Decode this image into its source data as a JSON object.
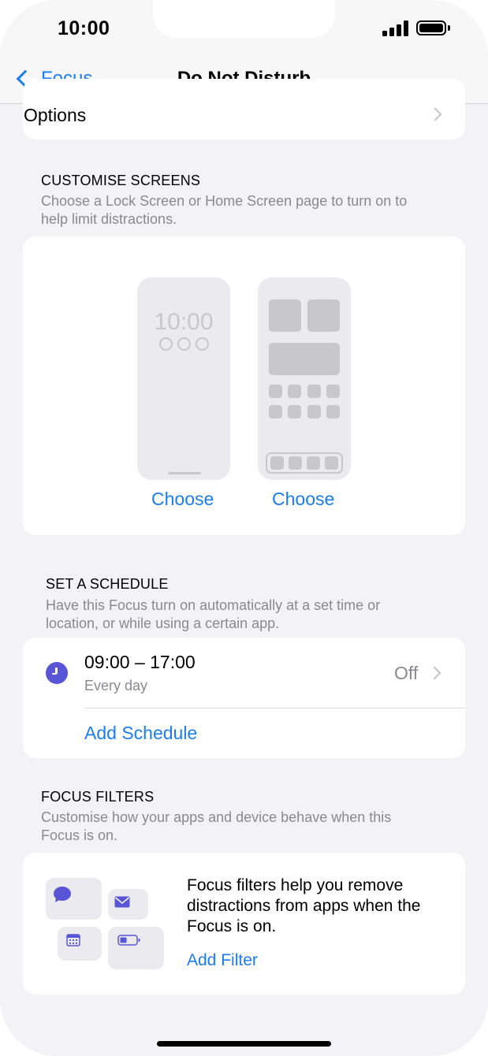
{
  "status_bar": {
    "time": "10:00"
  },
  "nav": {
    "back_label": "Focus",
    "title": "Do Not Disturb"
  },
  "options": {
    "label": "Options"
  },
  "customise": {
    "title": "CUSTOMISE SCREENS",
    "description_line1": "Choose a Lock Screen or Home Screen page to turn on to",
    "description_line2": "help limit distractions.",
    "lock_preview_time": "10:00",
    "lock_choose_label": "Choose",
    "home_choose_label": "Choose"
  },
  "schedule": {
    "title": "SET A SCHEDULE",
    "description_line1": "Have this Focus turn on automatically at a set time or",
    "description_line2": "location, or while using a certain app.",
    "entry": {
      "time_range": "09:00 – 17:00",
      "days": "Every day",
      "status": "Off"
    },
    "add_label": "Add Schedule"
  },
  "filters": {
    "title": "FOCUS FILTERS",
    "description_line1": "Customise how your apps and device behave when this",
    "description_line2": "Focus is on.",
    "info_text": "Focus filters help you remove distractions from apps when the Focus is on.",
    "add_label": "Add Filter",
    "icons": [
      "message-icon",
      "mail-icon",
      "calendar-icon",
      "battery-icon"
    ]
  },
  "colors": {
    "accent": "#1a7ef2",
    "schedule_icon": "#5856d6",
    "background": "#f2f2f7"
  }
}
